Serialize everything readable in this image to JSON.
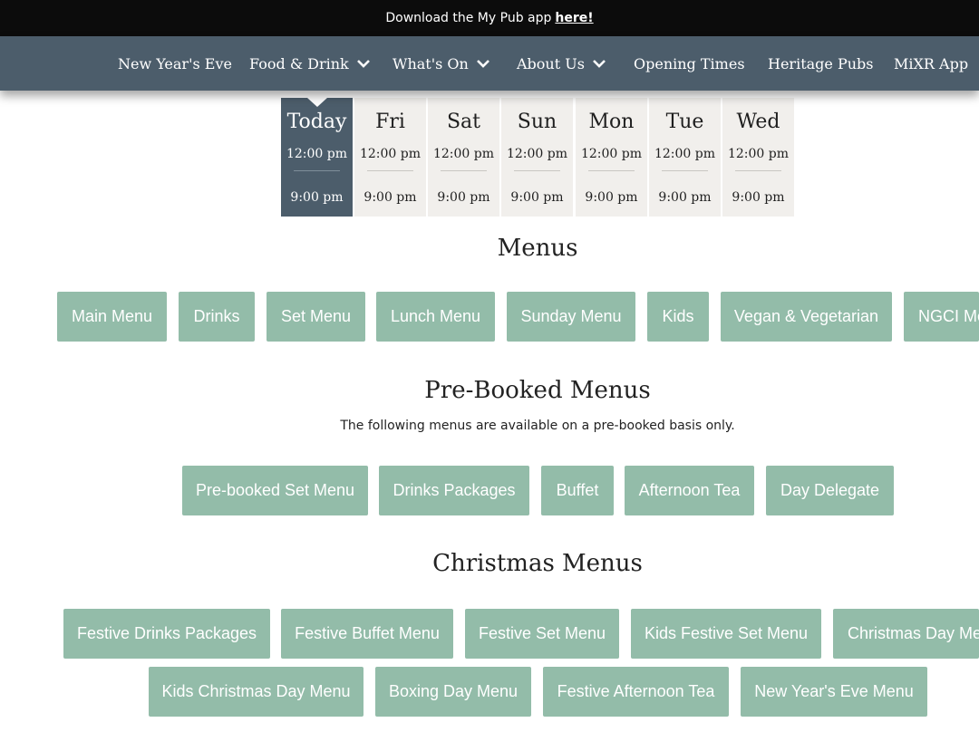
{
  "topbar": {
    "text": "Download the My Pub app",
    "link": "here!"
  },
  "nav": {
    "items": [
      {
        "label": "New Year's Eve",
        "has_dropdown": false
      },
      {
        "label": "Food & Drink",
        "has_dropdown": true
      },
      {
        "label": "What's On",
        "has_dropdown": true
      },
      {
        "label": "About Us",
        "has_dropdown": true
      },
      {
        "label": "Opening Times",
        "has_dropdown": false
      },
      {
        "label": "Heritage Pubs",
        "has_dropdown": false
      },
      {
        "label": "MiXR App",
        "has_dropdown": false
      }
    ]
  },
  "opening_times": [
    {
      "day": "Today",
      "open": "12:00 pm",
      "close": "9:00 pm",
      "active": true
    },
    {
      "day": "Fri",
      "open": "12:00 pm",
      "close": "9:00 pm"
    },
    {
      "day": "Sat",
      "open": "12:00 pm",
      "close": "9:00 pm"
    },
    {
      "day": "Sun",
      "open": "12:00 pm",
      "close": "9:00 pm"
    },
    {
      "day": "Mon",
      "open": "12:00 pm",
      "close": "9:00 pm"
    },
    {
      "day": "Tue",
      "open": "12:00 pm",
      "close": "9:00 pm"
    },
    {
      "day": "Wed",
      "open": "12:00 pm",
      "close": "9:00 pm"
    }
  ],
  "menus": {
    "heading": "Menus",
    "buttons": [
      "Main Menu",
      "Drinks",
      "Set Menu",
      "Lunch Menu",
      "Sunday Menu",
      "Kids",
      "Vegan & Vegetarian",
      "NGCI Me"
    ]
  },
  "prebooked": {
    "heading": "Pre-Booked Menus",
    "subtitle": "The following menus are available on a pre-booked basis only.",
    "buttons": [
      "Pre-booked Set Menu",
      "Drinks Packages",
      "Buffet",
      "Afternoon Tea",
      "Day Delegate"
    ]
  },
  "christmas": {
    "heading": "Christmas Menus",
    "row1": [
      "Festive Drinks Packages",
      "Festive Buffet Menu",
      "Festive Set Menu",
      "Kids Festive Set Menu",
      "Christmas Day Me"
    ],
    "row2": [
      "Kids Christmas Day Menu",
      "Boxing Day Menu",
      "Festive Afternoon Tea",
      "New Year's Eve Menu"
    ]
  },
  "colors": {
    "nav_bg": "#4c5d6b",
    "topbar_bg": "#0c0c0c",
    "button_bg": "#93bca9",
    "day_bg": "#f1efec"
  }
}
